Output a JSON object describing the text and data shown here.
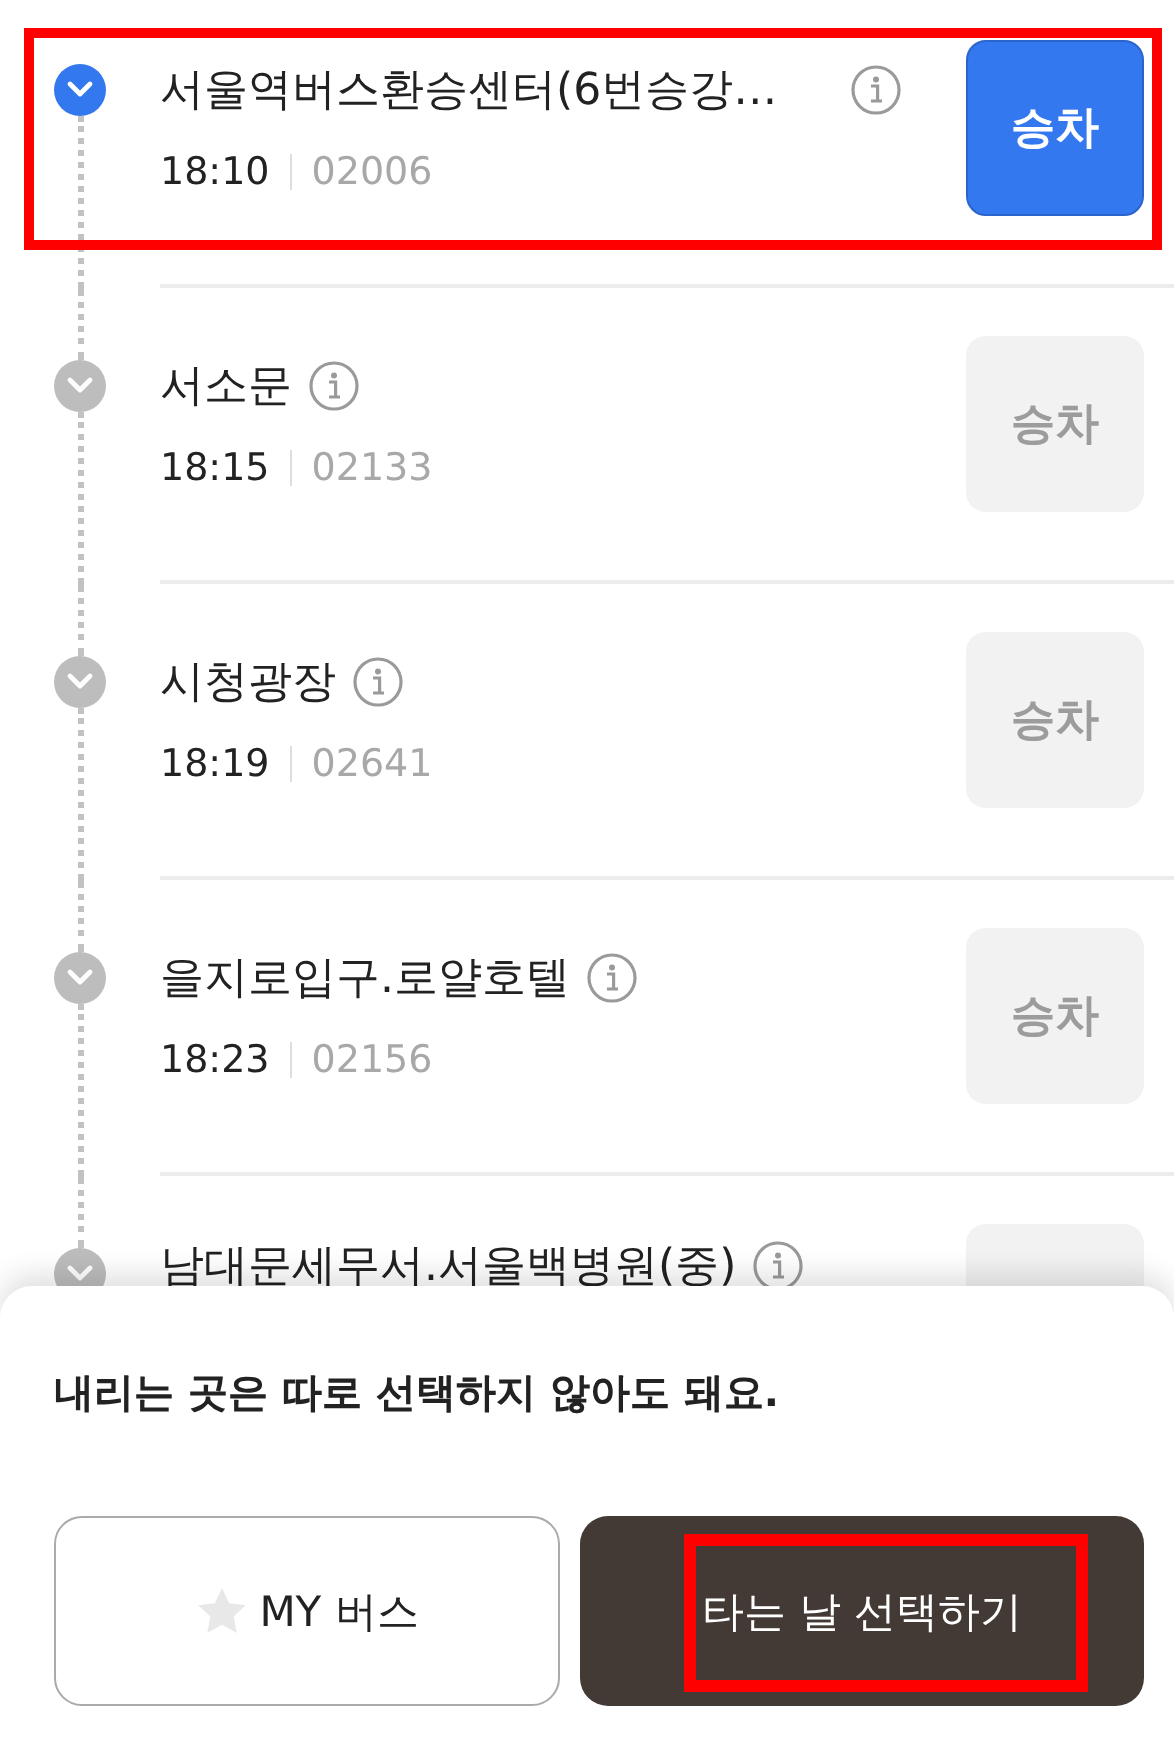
{
  "stops": [
    {
      "name": "서울역버스환승센터(6번승강…",
      "time": "18:10",
      "code": "02006",
      "board_label": "승차",
      "selected": true,
      "highlighted": true
    },
    {
      "name": "서소문",
      "time": "18:15",
      "code": "02133",
      "board_label": "승차",
      "selected": false,
      "highlighted": false
    },
    {
      "name": "시청광장",
      "time": "18:19",
      "code": "02641",
      "board_label": "승차",
      "selected": false,
      "highlighted": false
    },
    {
      "name": "을지로입구.로얄호텔",
      "time": "18:23",
      "code": "02156",
      "board_label": "승차",
      "selected": false,
      "highlighted": false
    },
    {
      "name": "남대문세무서.서울백병원(중)",
      "selected": false,
      "highlighted": false
    }
  ],
  "sheet": {
    "notice": "내리는 곳은 따로 선택하지 않아도 돼요.",
    "my_bus_button": "MY 버스",
    "primary_button": {
      "label": "타는 날 선택하기",
      "highlighted": true
    }
  }
}
